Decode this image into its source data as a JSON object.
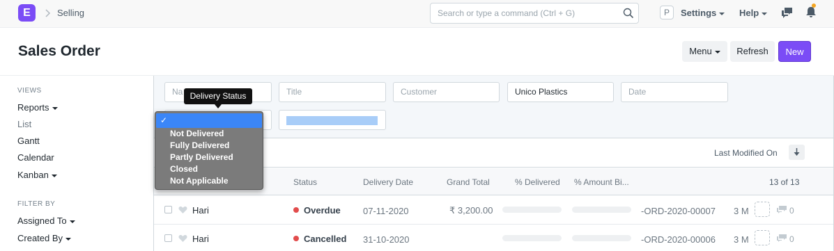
{
  "navbar": {
    "logo_letter": "E",
    "breadcrumb": "Selling",
    "search_placeholder": "Search or type a command (Ctrl + G)",
    "avatar_letter": "P",
    "settings_label": "Settings",
    "help_label": "Help",
    "icons": [
      "search-icon",
      "chat-icon",
      "bell-icon"
    ]
  },
  "page": {
    "title": "Sales Order",
    "menu_label": "Menu",
    "refresh_label": "Refresh",
    "new_label": "New",
    "accent_color": "#7b4cf6"
  },
  "sidebar": {
    "views_heading": "VIEWS",
    "views": [
      "Reports",
      "List",
      "Gantt",
      "Calendar",
      "Kanban"
    ],
    "filter_heading": "FILTER BY",
    "filters": [
      "Assigned To",
      "Created By"
    ]
  },
  "filters": {
    "name_placeholder": "Na",
    "title_placeholder": "Title",
    "customer_placeholder": "Customer",
    "company_value": "Unico Plastics",
    "date_placeholder": "Date"
  },
  "dropdown": {
    "tooltip": "Delivery Status",
    "selected_check": "✓",
    "options": [
      "Not Delivered",
      "Fully Delivered",
      "Partly Delivered",
      "Closed",
      "Not Applicable"
    ]
  },
  "list": {
    "sort_label": "Last Modified On",
    "columns": [
      "Status",
      "Delivery Date",
      "Grand Total",
      "% Delivered",
      "% Amount Bi..."
    ],
    "count": "13 of 13",
    "rows": [
      {
        "name": "Hari",
        "status": "Overdue",
        "delivery_date": "07-11-2020",
        "grand_total": "₹ 3,200.00",
        "id": "-ORD-2020-00007",
        "age": "3 M",
        "comments": "0"
      },
      {
        "name": "Hari",
        "status": "Cancelled",
        "delivery_date": "31-10-2020",
        "grand_total": "",
        "id": "-ORD-2020-00006",
        "age": "3 M",
        "comments": "0"
      }
    ]
  }
}
